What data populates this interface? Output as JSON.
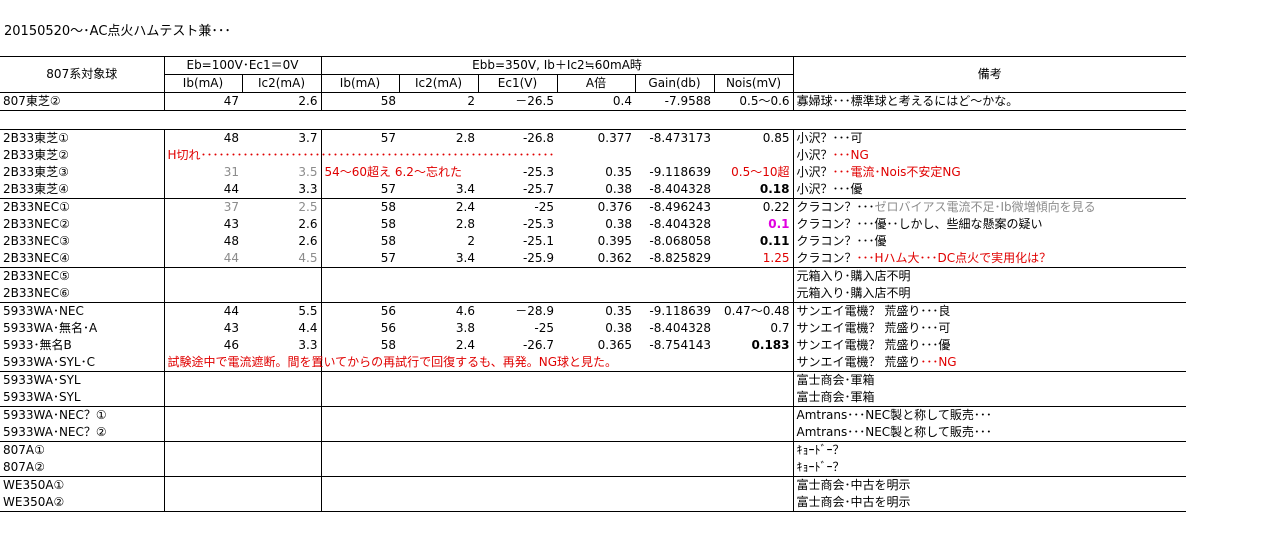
{
  "title": "20150520～･AC点火ハムテスト兼･･･",
  "header": {
    "tube": "807系対象球",
    "eb_group": "Eb=100V･Ec1＝0V",
    "ebb_group": "Ebb=350V, Ib＋Ic2≒60mA時",
    "remarks": "備考",
    "ib": "Ib(mA)",
    "ic2": "Ic2(mA)",
    "ec1": "Ec1(V)",
    "a": "A倍",
    "gain": "Gain(db)",
    "nois": "Nois(mV)"
  },
  "ref_row": {
    "name": "807東芝②",
    "ib1": "47",
    "ic21": "2.6",
    "ib2": "58",
    "ic22": "2",
    "ec1": "－26.5",
    "a": "0.4",
    "gain": "-7.9588",
    "nois": "0.5～0.6",
    "remark": "寡婦球･･･標準球と考えるにはど～かな。"
  },
  "groups": [
    {
      "rows": [
        {
          "name": "2B33東芝①",
          "ib1": "48",
          "ic21": "3.7",
          "ib2": "57",
          "ic22": "2.8",
          "ec1": "-26.8",
          "a": "0.377",
          "gain": "-8.473173",
          "nois": "0.85",
          "remark": "小沢？･･･可"
        },
        {
          "name": "2B33東芝②",
          "note": "H切れ･･･････････････････････････････････････････････････････････",
          "remark": "小沢？",
          "remark_red": "･･･NG"
        },
        {
          "name": "2B33東芝③",
          "ib1": "31",
          "ic21": "3.5",
          "gray1": true,
          "ib2_note": "54～60超え 6.2～忘れた",
          "ec1": "-25.3",
          "a": "0.35",
          "gain": "-9.118639",
          "nois": "0.5～10超",
          "nois_style": "red",
          "remark": "小沢？",
          "remark_red": "･･･電流･Nois不安定NG"
        },
        {
          "name": "2B33東芝④",
          "ib1": "44",
          "ic21": "3.3",
          "ib2": "57",
          "ic22": "3.4",
          "ec1": "-25.7",
          "a": "0.38",
          "gain": "-8.404328",
          "nois": "0.18",
          "nois_style": "bold",
          "remark": "小沢？･･･優"
        }
      ]
    },
    {
      "rows": [
        {
          "name": "2B33NEC①",
          "ib1": "37",
          "ic21": "2.5",
          "gray1": true,
          "ib2": "58",
          "ic22": "2.4",
          "ec1": "-25",
          "a": "0.376",
          "gain": "-8.496243",
          "nois": "0.22",
          "remark": "クラコン？･･･",
          "remark_gray": "ゼロバイアス電流不足･Ib微増傾向を見る"
        },
        {
          "name": "2B33NEC②",
          "ib1": "43",
          "ic21": "2.6",
          "ib2": "58",
          "ic22": "2.8",
          "ec1": "-25.3",
          "a": "0.38",
          "gain": "-8.404328",
          "nois": "0.1",
          "nois_style": "mag",
          "remark": "クラコン？･･･優･･しかし、些細な懸案の疑い"
        },
        {
          "name": "2B33NEC③",
          "ib1": "48",
          "ic21": "2.6",
          "ib2": "58",
          "ic22": "2",
          "ec1": "-25.1",
          "a": "0.395",
          "gain": "-8.068058",
          "nois": "0.11",
          "nois_style": "bold",
          "remark": "クラコン？･･･優"
        },
        {
          "name": "2B33NEC④",
          "ib1": "44",
          "ic21": "4.5",
          "gray1": true,
          "ib2": "57",
          "ic22": "3.4",
          "ec1": "-25.9",
          "a": "0.362",
          "gain": "-8.825829",
          "nois": "1.25",
          "nois_style": "red",
          "remark": "クラコン？",
          "remark_red": "･･･Hハム大･･･DC点火で実用化は？"
        }
      ]
    },
    {
      "rows": [
        {
          "name": "2B33NEC⑤",
          "remark": "元箱入り･購入店不明"
        },
        {
          "name": "2B33NEC⑥",
          "remark": "元箱入り･購入店不明"
        }
      ]
    },
    {
      "rows": [
        {
          "name": "5933WA･NEC",
          "ib1": "44",
          "ic21": "5.5",
          "ib2": "56",
          "ic22": "4.6",
          "ec1": "－28.9",
          "a": "0.35",
          "gain": "-9.118639",
          "nois": "0.47～0.48",
          "remark": "サンエイ電機？ 荒盛り･･･良"
        },
        {
          "name": "5933WA･無名･A",
          "ib1": "43",
          "ic21": "4.4",
          "ib2": "56",
          "ic22": "3.8",
          "ec1": "-25",
          "a": "0.38",
          "gain": "-8.404328",
          "nois": "0.7",
          "remark": "サンエイ電機？ 荒盛り･･･可"
        },
        {
          "name": "5933･無名B",
          "ib1": "46",
          "ic21": "3.3",
          "ib2": "58",
          "ic22": "2.4",
          "ec1": "-26.7",
          "a": "0.365",
          "gain": "-8.754143",
          "nois": "0.183",
          "nois_style": "bold",
          "remark": "サンエイ電機？ 荒盛り･･･優"
        },
        {
          "name": "5933WA･SYL･C",
          "note": "試験途中で電流遮断。間を置いてからの再試行で回復するも、再発。NG球と見た。",
          "remark": "サンエイ電機？ 荒盛り",
          "remark_red": "･･･NG"
        }
      ]
    },
    {
      "rows": [
        {
          "name": "5933WA･SYL",
          "remark": "富士商会･軍箱"
        },
        {
          "name": "5933WA･SYL",
          "remark": "富士商会･軍箱"
        }
      ]
    },
    {
      "rows": [
        {
          "name": "5933WA･NEC？①",
          "remark": "Amtrans･･･NEC製と称して販売･･･"
        },
        {
          "name": "5933WA･NEC？②",
          "remark": "Amtrans･･･NEC製と称して販売･･･"
        }
      ]
    },
    {
      "rows": [
        {
          "name": "807A①",
          "remark": "ｷｮｰﾄﾞｰ？"
        },
        {
          "name": "807A②",
          "remark": "ｷｮｰﾄﾞｰ？"
        }
      ]
    },
    {
      "rows": [
        {
          "name": "WE350A①",
          "remark": "富士商会･中古を明示"
        },
        {
          "name": "WE350A②",
          "remark": "富士商会･中古を明示"
        }
      ]
    }
  ]
}
